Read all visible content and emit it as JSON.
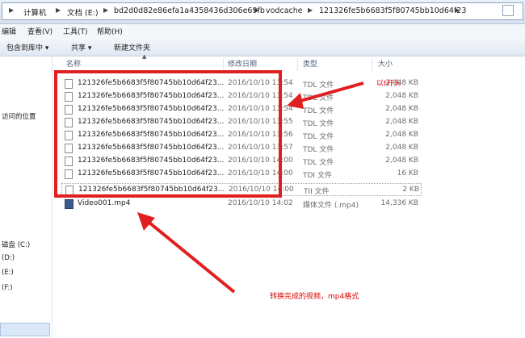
{
  "address": {
    "crumbs": [
      "计算机",
      "文档 (E:)",
      "bd2d0d82e86efa1a4358436d306e69fb",
      "vodcache",
      "121326fe5b6683f5f80745bb10d64f23"
    ]
  },
  "menu": {
    "edit": "编辑",
    "view": "查看(V)",
    "tools": "工具(T)",
    "help": "帮助(H)"
  },
  "toolbar": {
    "include": "包含到库中 ▾",
    "share": "共享 ▾",
    "newfolder": "新建文件夹"
  },
  "nav": {
    "items": [
      "访问的位置",
      "磁盘 (C:)",
      "(D:)",
      "(E:)",
      "(F:)"
    ]
  },
  "columns": {
    "name": "名称",
    "date": "修改日期",
    "type": "类型",
    "size": "大小"
  },
  "files": [
    {
      "name": "121326fe5b6683f5f80745bb10d64f23...",
      "date": "2016/10/10 13:54",
      "type": "TDL 文件",
      "size": "2,048 KB"
    },
    {
      "name": "121326fe5b6683f5f80745bb10d64f23...",
      "date": "2016/10/10 13:54",
      "type": "TDL 文件",
      "size": "2,048 KB"
    },
    {
      "name": "121326fe5b6683f5f80745bb10d64f23...",
      "date": "2016/10/10 13:54",
      "type": "TDL 文件",
      "size": "2,048 KB"
    },
    {
      "name": "121326fe5b6683f5f80745bb10d64f23...",
      "date": "2016/10/10 13:55",
      "type": "TDL 文件",
      "size": "2,048 KB"
    },
    {
      "name": "121326fe5b6683f5f80745bb10d64f23...",
      "date": "2016/10/10 13:56",
      "type": "TDL 文件",
      "size": "2,048 KB"
    },
    {
      "name": "121326fe5b6683f5f80745bb10d64f23...",
      "date": "2016/10/10 13:57",
      "type": "TDL 文件",
      "size": "2,048 KB"
    },
    {
      "name": "121326fe5b6683f5f80745bb10d64f23...",
      "date": "2016/10/10 14:00",
      "type": "TDL 文件",
      "size": "2,048 KB"
    },
    {
      "name": "121326fe5b6683f5f80745bb10d64f23...",
      "date": "2016/10/10 14:00",
      "type": "TDI 文件",
      "size": "16 KB"
    },
    {
      "name": "121326fe5b6683f5f80745bb10d64f23...",
      "date": "2016/10/10 14:00",
      "type": "TII 文件",
      "size": "2 KB"
    },
    {
      "name": "Video001.mp4",
      "date": "2016/10/10 14:02",
      "type": "媒体文件 (.mp4)",
      "size": "14,336 KB"
    }
  ],
  "annotations": {
    "tdl_note": "以t开头",
    "mp4_note": "转换完成的视频，mp4格式"
  },
  "colors": {
    "annotation": "#e02020"
  }
}
